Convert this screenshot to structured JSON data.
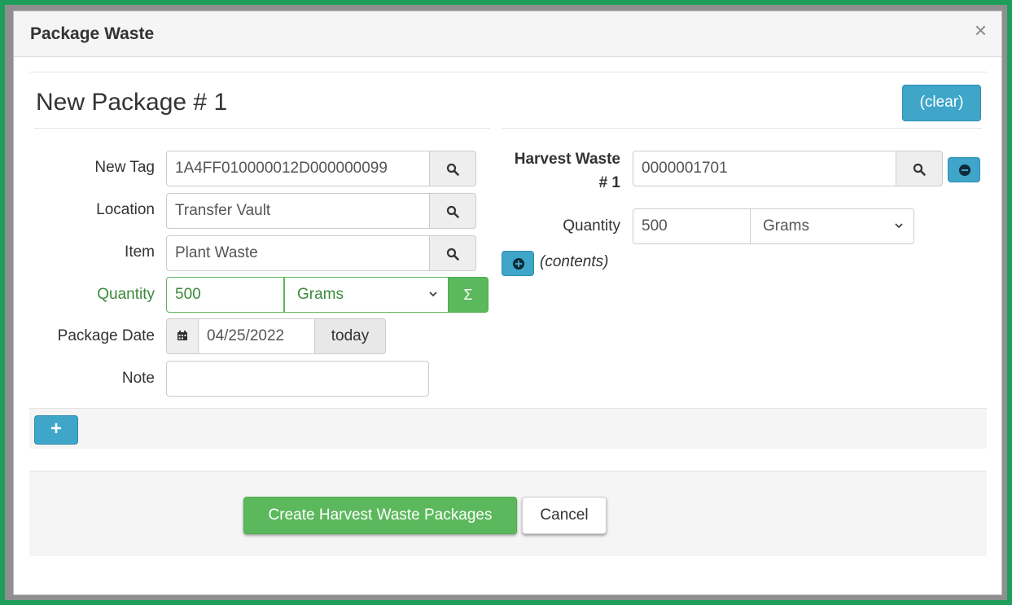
{
  "modal": {
    "title": "Package Waste",
    "close_label": "×"
  },
  "package": {
    "title": "New Package # 1",
    "clear_label": "(clear)",
    "new_tag": {
      "label": "New Tag",
      "value": "1A4FF010000012D000000099"
    },
    "location": {
      "label": "Location",
      "value": "Transfer Vault"
    },
    "item": {
      "label": "Item",
      "value": "Plant Waste"
    },
    "quantity": {
      "label": "Quantity",
      "value": "500",
      "unit": "Grams",
      "sum_label": "Σ"
    },
    "package_date": {
      "label": "Package Date",
      "value": "04/25/2022",
      "today_label": "today"
    },
    "note": {
      "label": "Note",
      "value": ""
    }
  },
  "harvest_waste": {
    "label_line1": "Harvest Waste",
    "label_line2": "# 1",
    "value": "0000001701",
    "quantity_label": "Quantity",
    "quantity_value": "500",
    "quantity_unit": "Grams",
    "contents_label": "(contents)"
  },
  "add_package_label": "+",
  "footer": {
    "create_label": "Create Harvest Waste Packages",
    "cancel_label": "Cancel"
  },
  "colors": {
    "frame": "#1f9e5b",
    "info_button": "#3fa5c9",
    "success_button": "#5cb85c",
    "quantity_label": "#3c8a3c"
  }
}
